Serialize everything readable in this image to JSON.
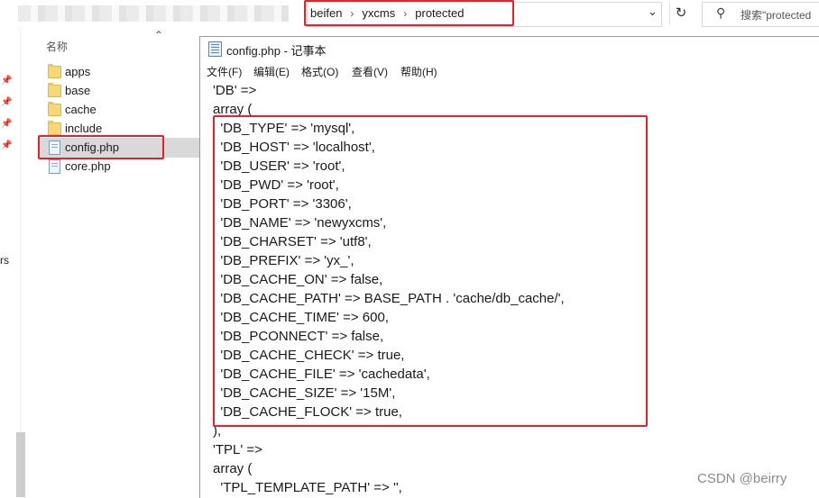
{
  "explorer": {
    "breadcrumbs": [
      "beifen",
      "yxcms",
      "protected"
    ],
    "search_placeholder": "搜索\"protected",
    "column_header": "名称",
    "left_cut_text": "rs",
    "files": [
      {
        "name": "apps",
        "type": "folder"
      },
      {
        "name": "base",
        "type": "folder"
      },
      {
        "name": "cache",
        "type": "folder"
      },
      {
        "name": "include",
        "type": "folder"
      },
      {
        "name": "config.php",
        "type": "file",
        "selected": true
      },
      {
        "name": "core.php",
        "type": "file"
      }
    ]
  },
  "notepad": {
    "title": "config.php - 记事本",
    "menu": [
      "文件(F)",
      "编辑(E)",
      "格式(O)",
      "查看(V)",
      "帮助(H)"
    ],
    "lines": [
      "'DB' =>",
      "array (",
      "  'DB_TYPE' => 'mysql',",
      "  'DB_HOST' => 'localhost',",
      "  'DB_USER' => 'root',",
      "  'DB_PWD' => 'root',",
      "  'DB_PORT' => '3306',",
      "  'DB_NAME' => 'newyxcms',",
      "  'DB_CHARSET' => 'utf8',",
      "  'DB_PREFIX' => 'yx_',",
      "  'DB_CACHE_ON' => false,",
      "  'DB_CACHE_PATH' => BASE_PATH . 'cache/db_cache/',",
      "  'DB_CACHE_TIME' => 600,",
      "  'DB_PCONNECT' => false,",
      "  'DB_CACHE_CHECK' => true,",
      "  'DB_CACHE_FILE' => 'cachedata',",
      "  'DB_CACHE_SIZE' => '15M',",
      "  'DB_CACHE_FLOCK' => true,",
      "),",
      "'TPL' =>",
      "array (",
      "  'TPL_TEMPLATE_PATH' => '',"
    ]
  },
  "watermark": "CSDN @beirry",
  "colors": {
    "highlight": "#e8202b",
    "selection": "#d9d9d9",
    "folder": "#f8d775"
  }
}
